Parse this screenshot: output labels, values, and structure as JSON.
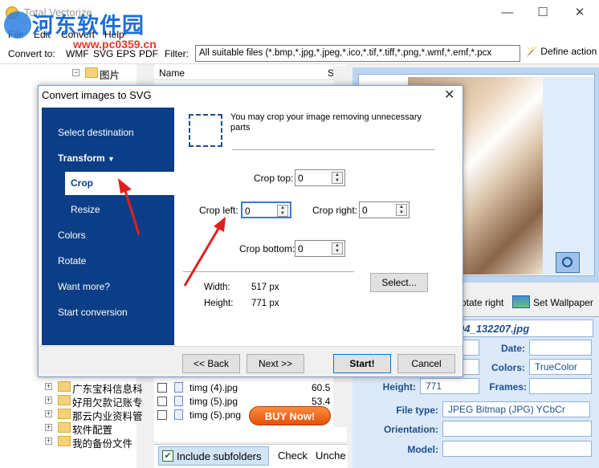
{
  "app": {
    "title": "Total Vectorize"
  },
  "watermark": {
    "text": "河东软件园",
    "url": "www.pc0359.cn"
  },
  "menu": [
    "File",
    "Edit",
    "Convert",
    "Help"
  ],
  "toolbar": {
    "convert_to": "Convert to:",
    "formats": [
      "WMF",
      "SVG",
      "EPS",
      "PDF"
    ],
    "filter_label": "Filter:",
    "filter_value": "All suitable files (*.bmp,*.jpg,*.jpeg,*.ico,*.tif,*.tiff,*.png,*.wmf,*.emf,*.pcx",
    "define_action": "Define action"
  },
  "tree": {
    "top_item": "图片",
    "items": [
      "广东宝科信息科",
      "好用欠款记账专",
      "那云内业资料管",
      "软件配置",
      "我的备份文件"
    ]
  },
  "file_list": {
    "header_name": "Name",
    "header_size": "S",
    "rows": [
      {
        "name": "timg (4).jpg",
        "size": "60.5"
      },
      {
        "name": "timg (5).jpg",
        "size": "53.4"
      },
      {
        "name": "timg (5).png",
        "size": ""
      }
    ],
    "buy_now": "BUY Now!",
    "include_subfolders": "Include subfolders",
    "check": "Check",
    "uncheck": "Unche"
  },
  "preview": {
    "rotate_right": "otate right",
    "set_wallpaper": "Set Wallpaper"
  },
  "info": {
    "file_title": "04_132207.jpg",
    "date_label": "Date:",
    "colors_label": "Colors:",
    "colors_value": "TrueColor",
    "height_label": "Height:",
    "height_value": "771",
    "frames_label": "Frames:",
    "file_type_label": "File type:",
    "file_type_value": "JPEG Bitmap (JPG) YCbCr",
    "orientation_label": "Orientation:",
    "model_label": "Model:"
  },
  "dialog": {
    "title": "Convert images to SVG",
    "nav": {
      "select_destination": "Select destination",
      "transform": "Transform",
      "crop": "Crop",
      "resize": "Resize",
      "colors": "Colors",
      "rotate": "Rotate",
      "want_more": "Want more?",
      "start_conversion": "Start conversion"
    },
    "crop_description": "You may crop your image removing unnecessary parts",
    "crop_top_label": "Crop top:",
    "crop_top_value": "0",
    "crop_left_label": "Crop left:",
    "crop_left_value": "0",
    "crop_right_label": "Crop right:",
    "crop_right_value": "0",
    "crop_bottom_label": "Crop bottom:",
    "crop_bottom_value": "0",
    "width_label": "Width:",
    "width_value": "517 px",
    "height_label": "Height:",
    "height_value": "771 px",
    "select_button": "Select...",
    "back_button": "<< Back",
    "next_button": "Next >>",
    "start_button": "Start!",
    "cancel_button": "Cancel"
  },
  "colors": {
    "accent": "#0b3e86",
    "annotation_arrow": "#e02020",
    "buy_now": "#e2520c"
  }
}
